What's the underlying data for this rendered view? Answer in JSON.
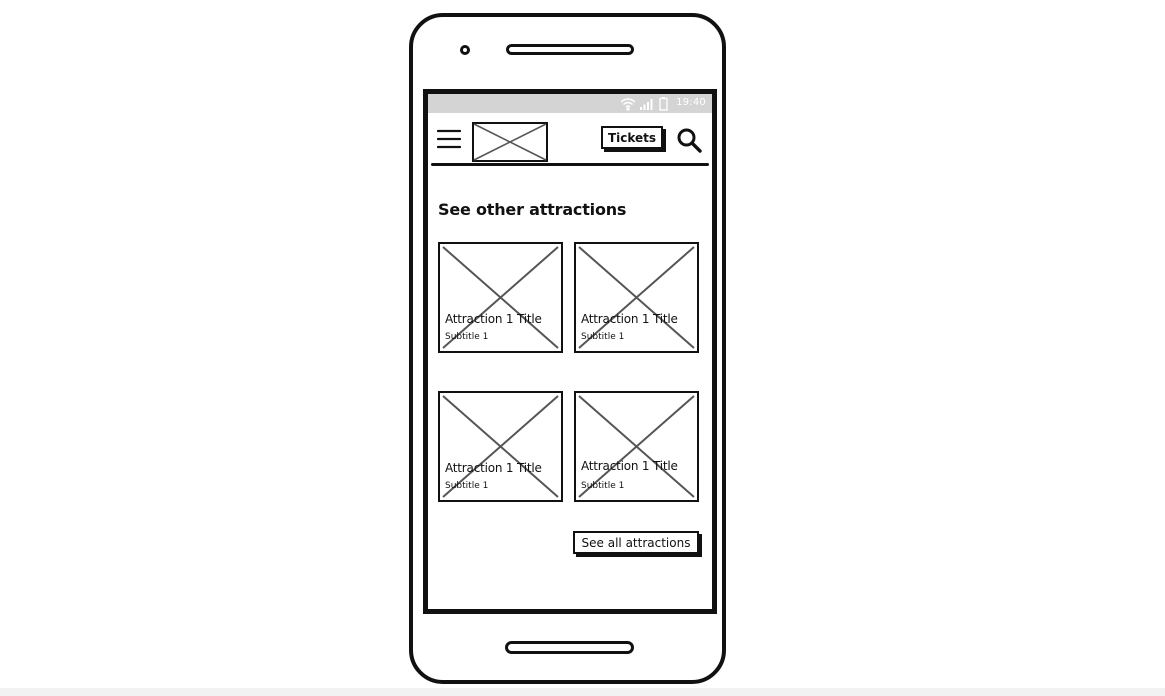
{
  "status_bar": {
    "time": "19:40",
    "icons": [
      "wifi-icon",
      "signal-icon",
      "battery-icon"
    ]
  },
  "header": {
    "menu_icon": "hamburger-menu-icon",
    "logo": "logo-placeholder",
    "tickets_label": "Tickets",
    "search_icon": "search-icon"
  },
  "main": {
    "section_title": "See other attractions",
    "cards": [
      {
        "title": "Attraction 1 Title",
        "subtitle": "Subtitle 1"
      },
      {
        "title": "Attraction 1 Title",
        "subtitle": "Subtitle 1"
      },
      {
        "title": "Attraction 1 Title",
        "subtitle": "Subtitle 1"
      },
      {
        "title": "Attraction 1 Title",
        "subtitle": "Subtitle 1"
      }
    ],
    "see_all_label": "See all attractions"
  },
  "colors": {
    "ink": "#111111",
    "status_bar_bg": "#d4d4d4",
    "placeholder_x": "#555555"
  }
}
